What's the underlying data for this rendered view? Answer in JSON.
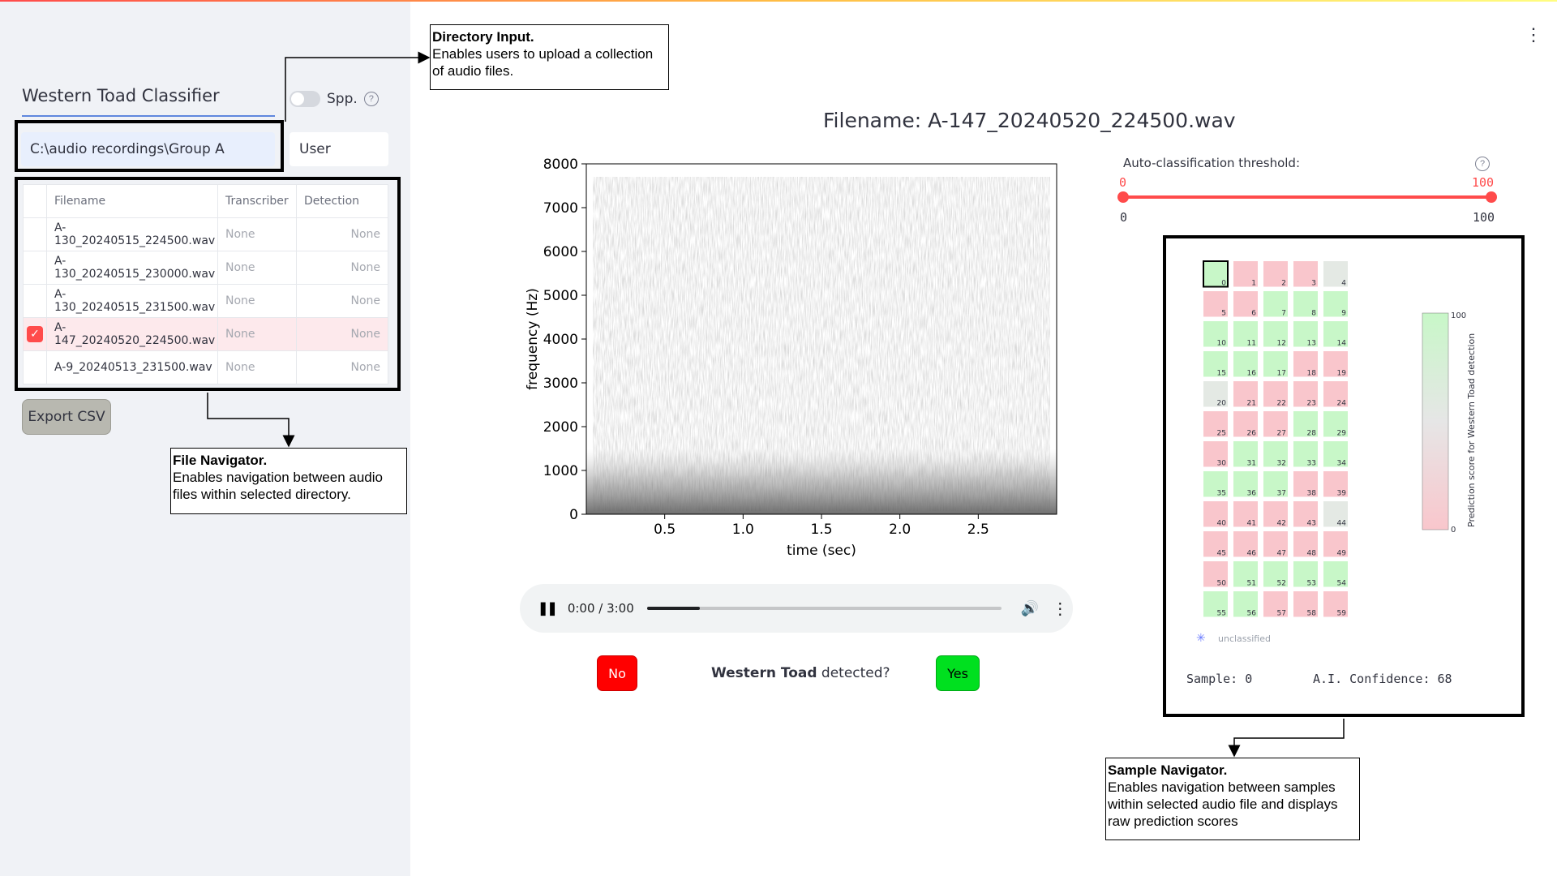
{
  "sidebar": {
    "app_title": "Western Toad Classifier",
    "spp_label": "Spp.",
    "directory_value": "C:\\audio recordings\\Group A",
    "user_value": "User",
    "export_label": "Export CSV",
    "table": {
      "headers": [
        "Filename",
        "Transcriber",
        "Detection"
      ],
      "rows": [
        {
          "filename": "A-130_20240515_224500.wav",
          "transcriber": "None",
          "detection": "None",
          "selected": false
        },
        {
          "filename": "A-130_20240515_230000.wav",
          "transcriber": "None",
          "detection": "None",
          "selected": false
        },
        {
          "filename": "A-130_20240515_231500.wav",
          "transcriber": "None",
          "detection": "None",
          "selected": false
        },
        {
          "filename": "A-147_20240520_224500.wav",
          "transcriber": "None",
          "detection": "None",
          "selected": true
        },
        {
          "filename": "A-9_20240513_231500.wav",
          "transcriber": "None",
          "detection": "None",
          "selected": false
        }
      ]
    }
  },
  "callouts": {
    "directory": {
      "title": "Directory Input.",
      "body": "Enables users to upload a collection of audio files."
    },
    "file_nav": {
      "title": "File Navigator.",
      "body": "Enables navigation between audio files within selected directory."
    },
    "sample_nav": {
      "title": "Sample Navigator.",
      "body": "Enables navigation between samples within selected audio file and displays raw prediction scores"
    }
  },
  "main": {
    "filename_title": "Filename: A-147_20240520_224500.wav",
    "audio": {
      "time": "0:00 / 3:00",
      "progress": 0.15
    },
    "question_bold": "Western Toad",
    "question_rest": " detected?",
    "no_label": "No",
    "yes_label": "Yes"
  },
  "chart_data": {
    "type": "heatmap",
    "title": "",
    "xlabel": "time (sec)",
    "ylabel": "frequency (Hz)",
    "xticks": [
      "0.5",
      "1.0",
      "1.5",
      "2.0",
      "2.5"
    ],
    "yticks": [
      "0",
      "1000",
      "2000",
      "3000",
      "4000",
      "5000",
      "6000",
      "7000",
      "8000"
    ],
    "xlim": [
      0,
      3.0
    ],
    "ylim": [
      0,
      8000
    ]
  },
  "threshold": {
    "label": "Auto-classification threshold:",
    "low": "0",
    "high": "100",
    "min": "0",
    "max": "100",
    "low_value": 0,
    "high_value": 100
  },
  "sample_grid": {
    "labels": [
      "0",
      "1",
      "2",
      "3",
      "4",
      "5",
      "6",
      "7",
      "8",
      "9",
      "10",
      "11",
      "12",
      "13",
      "14",
      "15",
      "16",
      "17",
      "18",
      "19",
      "20",
      "21",
      "22",
      "23",
      "24",
      "25",
      "26",
      "27",
      "28",
      "29",
      "30",
      "31",
      "32",
      "33",
      "34",
      "35",
      "36",
      "37",
      "38",
      "39",
      "40",
      "41",
      "42",
      "43",
      "44",
      "45",
      "46",
      "47",
      "48",
      "49",
      "50",
      "51",
      "52",
      "53",
      "54",
      "55",
      "56",
      "57",
      "58",
      "59"
    ],
    "classes": [
      "g",
      "r",
      "r",
      "r",
      "n",
      "r",
      "r",
      "g",
      "g",
      "g",
      "g",
      "g",
      "g",
      "g",
      "g",
      "g",
      "g",
      "g",
      "r",
      "r",
      "n",
      "r",
      "r",
      "r",
      "r",
      "r",
      "r",
      "r",
      "g",
      "g",
      "r",
      "g",
      "g",
      "g",
      "g",
      "g",
      "g",
      "g",
      "r",
      "r",
      "r",
      "r",
      "r",
      "r",
      "n",
      "r",
      "r",
      "r",
      "r",
      "r",
      "r",
      "g",
      "g",
      "g",
      "g",
      "g",
      "g",
      "r",
      "r",
      "r"
    ],
    "selected_index": 0,
    "colorbar_label": "Prediction score for Western Toad detection",
    "colorbar_max": "100",
    "colorbar_min": "0",
    "legend_label": "unclassified",
    "sample_text": "Sample: 0",
    "confidence_text": "A.I. Confidence: 68"
  },
  "colors": {
    "accent": "#ff4b4b",
    "positive": "#c8f7c8",
    "negative": "#f9c6cc",
    "neutral": "#e4e9e4"
  }
}
